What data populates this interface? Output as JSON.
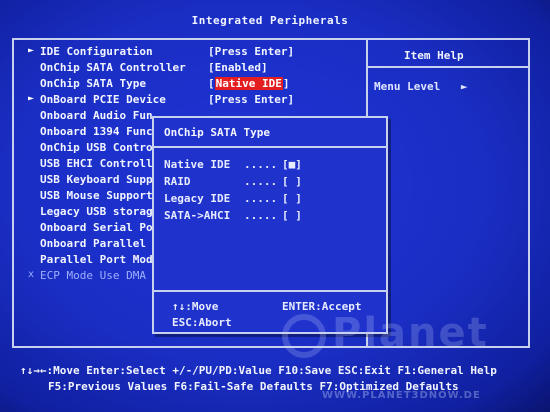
{
  "title": "Integrated Peripherals",
  "help_panel": {
    "title": "Item Help",
    "menu_level_label": "Menu Level",
    "menu_level_arrow": "►"
  },
  "rows": [
    {
      "ptr": "►",
      "label": "IDE Configuration",
      "value": "[Press Enter]"
    },
    {
      "ptr": "",
      "label": "OnChip SATA Controller",
      "value": "[Enabled]"
    },
    {
      "ptr": "",
      "label": "OnChip SATA Type",
      "value_prefix": "[",
      "value_hl": "Native IDE",
      "value_suffix": "]"
    },
    {
      "ptr": "►",
      "label": "OnBoard PCIE Device",
      "value": "[Press Enter]"
    },
    {
      "ptr": "",
      "label": "Onboard Audio Fun",
      "value": ""
    },
    {
      "ptr": "",
      "label": "Onboard 1394 Func",
      "value": ""
    },
    {
      "ptr": "",
      "label": "OnChip USB Contro",
      "value": ""
    },
    {
      "ptr": "",
      "label": "USB EHCI Controll",
      "value": ""
    },
    {
      "ptr": "",
      "label": "USB Keyboard Supp",
      "value": ""
    },
    {
      "ptr": "",
      "label": "USB Mouse Support",
      "value": ""
    },
    {
      "ptr": "",
      "label": "Legacy USB storag",
      "value": ""
    },
    {
      "ptr": "",
      "label": "Onboard Serial Po",
      "value": ""
    },
    {
      "ptr": "",
      "label": "Onboard Parallel",
      "value": ""
    },
    {
      "ptr": "",
      "label": "Parallel Port Mod",
      "value": ""
    },
    {
      "ptr": "x",
      "label": "ECP Mode Use DMA",
      "value": "",
      "dim": true
    }
  ],
  "popup": {
    "title": "OnChip SATA Type",
    "options": [
      {
        "label": "Native IDE",
        "dots": ".....",
        "box": "[■]"
      },
      {
        "label": "RAID",
        "dots": ".....",
        "box": "[ ]"
      },
      {
        "label": "Legacy IDE",
        "dots": ".....",
        "box": "[ ]"
      },
      {
        "label": "SATA->AHCI",
        "dots": ".....",
        "box": "[ ]"
      }
    ],
    "help_move": "↑↓:Move",
    "help_accept": "ENTER:Accept",
    "help_abort": "ESC:Abort"
  },
  "status": {
    "line1": "↑↓→←:Move  Enter:Select  +/-/PU/PD:Value  F10:Save  ESC:Exit  F1:General Help",
    "line2": "F5:Previous Values  F6:Fail-Safe Defaults  F7:Optimized Defaults"
  },
  "watermark": {
    "text": "Planet",
    "url": "WWW.PLANET3DNOW.DE"
  },
  "colors": {
    "background": "#1a2ec4",
    "highlight": "#e41d20",
    "text": "#e8ecff"
  }
}
